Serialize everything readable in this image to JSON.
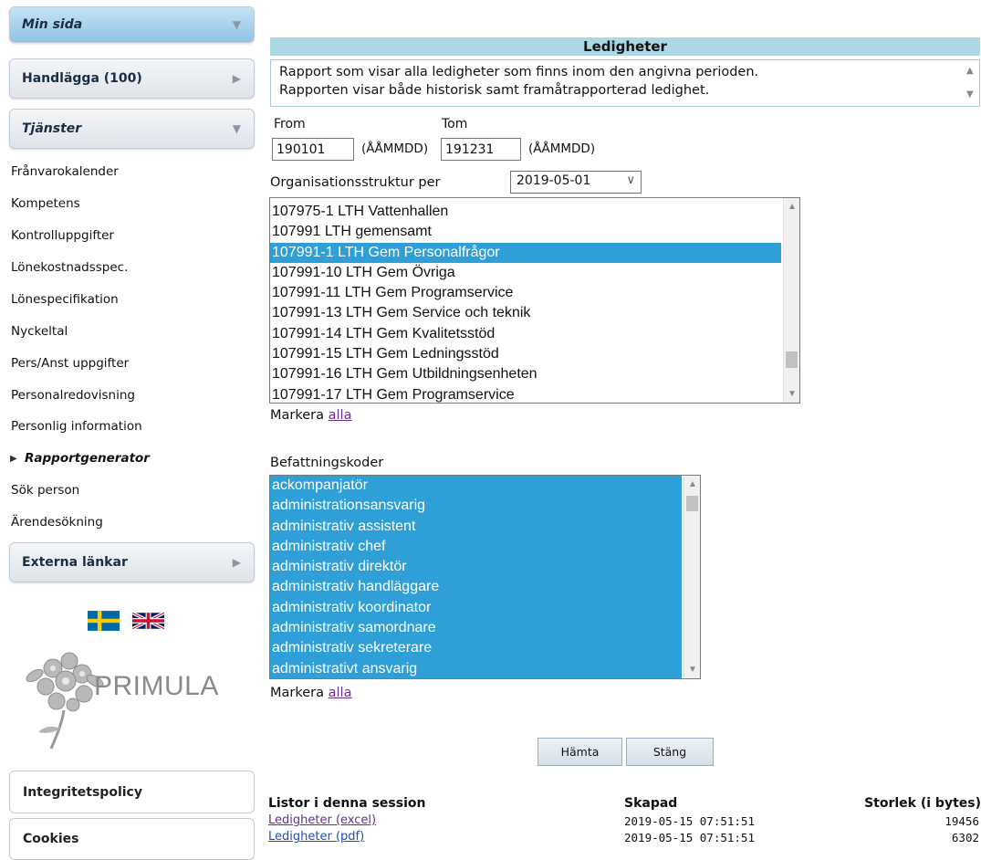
{
  "sidebar": {
    "min_sida": "Min sida",
    "handlagga": "Handlägga (100)",
    "tjanster": "Tjänster",
    "items": [
      "Frånvarokalender",
      "Kompetens",
      "Kontrolluppgifter",
      "Lönekostnadsspec.",
      "Lönespecifikation",
      "Nyckeltal",
      "Pers/Anst uppgifter",
      "Personalredovisning",
      "Personlig information",
      "Rapportgenerator",
      "Sök person",
      "Ärendesökning"
    ],
    "current_item": "Rapportgenerator",
    "externa": "Externa länkar",
    "logo_text": "PRIMULA",
    "integritet": "Integritetspolicy",
    "cookies": "Cookies"
  },
  "report": {
    "title": "Ledigheter",
    "description_line1": "Rapport som visar alla ledigheter som finns inom den angivna perioden.",
    "description_line2": "Rapporten visar både historisk samt framåtrapporterad ledighet.",
    "from_label": "From",
    "tom_label": "Tom",
    "from_value": "190101",
    "tom_value": "191231",
    "date_format": "(ÅÅMMDD)",
    "org_label": "Organisationsstruktur per",
    "org_date": "2019-05-01",
    "org_units": [
      "107975-1 LTH Vattenhallen",
      "107991 LTH gemensamt",
      "107991-1 LTH Gem Personalfrågor",
      "107991-10 LTH Gem Övriga",
      "107991-11 LTH Gem Programservice",
      "107991-13 LTH Gem Service och teknik",
      "107991-14 LTH Gem Kvalitetsstöd",
      "107991-15 LTH Gem Ledningsstöd",
      "107991-16 LTH Gem Utbildningsenheten",
      "107991-17 LTH Gem Programservice"
    ],
    "org_selected": "107991-1 LTH Gem Personalfrågor",
    "markera": "Markera",
    "alla": "alla",
    "bef_label": "Befattningskoder",
    "bef_codes": [
      "ackompanjatör",
      "administrationsansvarig",
      "administrativ assistent",
      "administrativ chef",
      "administrativ direktör",
      "administrativ handläggare",
      "administrativ koordinator",
      "administrativ samordnare",
      "administrativ sekreterare",
      "administrativt ansvarig"
    ],
    "hamta": "Hämta",
    "stang": "Stäng"
  },
  "session": {
    "col_lists": "Listor i denna session",
    "col_created": "Skapad",
    "col_size": "Storlek (i bytes)",
    "rows": [
      {
        "name": "Ledigheter (excel)",
        "created": "2019-05-15 07:51:51",
        "size": "19456"
      },
      {
        "name": "Ledigheter (pdf)",
        "created": "2019-05-15 07:51:51",
        "size": "6302"
      }
    ]
  },
  "colors": {
    "header_bg": "#acd8e6",
    "selection": "#2f9fd8",
    "active_menu": "#a9d4f0"
  }
}
